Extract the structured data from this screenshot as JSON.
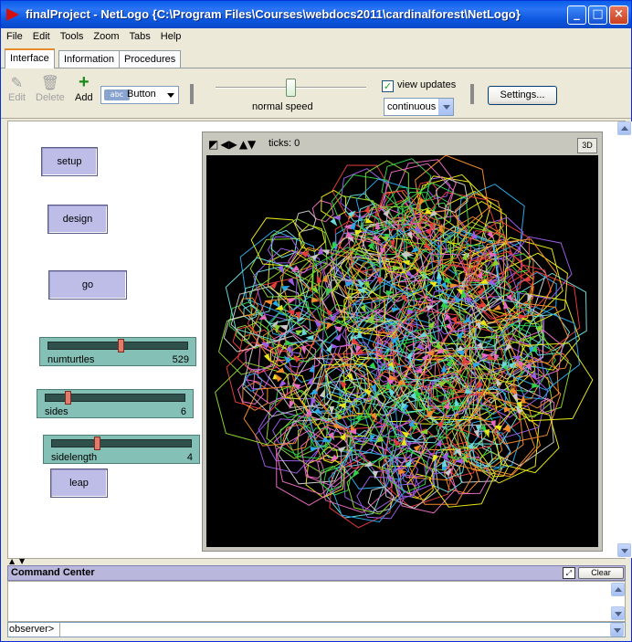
{
  "window": {
    "title": "finalProject - NetLogo {C:\\Program Files\\Courses\\webdocs2011\\cardinalforest\\NetLogo}",
    "minimize_label": "_",
    "maximize_label": "□",
    "close_label": "×"
  },
  "menu": [
    "File",
    "Edit",
    "Tools",
    "Zoom",
    "Tabs",
    "Help"
  ],
  "tabs": [
    "Interface",
    "Information",
    "Procedures"
  ],
  "toolbar": {
    "edit_label": "Edit",
    "delete_label": "Delete",
    "add_label": "Add",
    "widget_type": "Button",
    "widget_type_icon": "abc",
    "speed_label": "normal speed",
    "speed_fraction": 0.5,
    "view_updates_label": "view updates",
    "view_updates_checked": true,
    "update_mode": "continuous",
    "settings_label": "Settings..."
  },
  "widgets": {
    "setup_label": "setup",
    "design_label": "design",
    "go_label": "go",
    "leap_label": "leap",
    "sliders": [
      {
        "name": "numturtles",
        "value": "529",
        "fraction": 0.55
      },
      {
        "name": "sides",
        "value": "6",
        "fraction": 0.17
      },
      {
        "name": "sidelength",
        "value": "4",
        "fraction": 0.33
      }
    ]
  },
  "view": {
    "ticks_text": "ticks: 0",
    "btn_3d": "3D",
    "background": "#000000"
  },
  "command_center": {
    "title": "Command Center",
    "clear_label": "Clear",
    "prompt": "observer>",
    "input_value": ""
  }
}
